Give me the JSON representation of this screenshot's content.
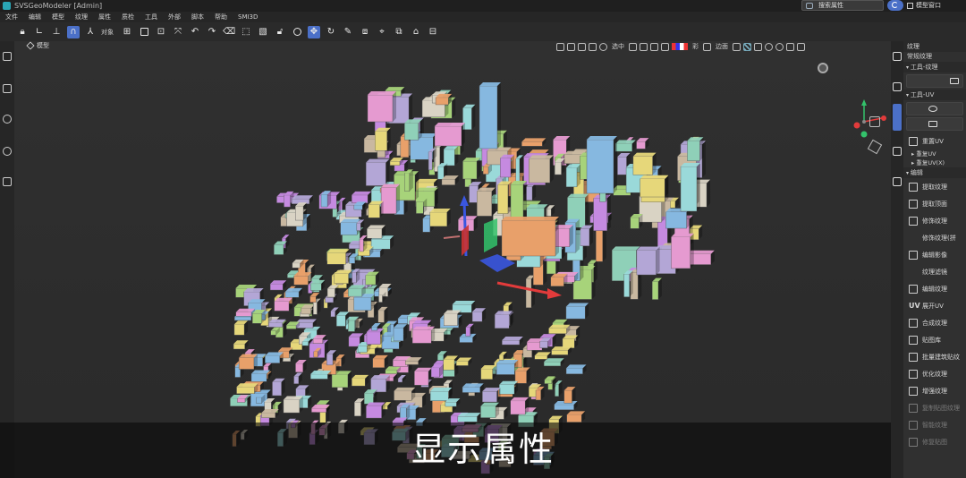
{
  "window": {
    "title": "SVSGeoModeler [Admin]",
    "search_text": "搜索属性",
    "window_menu": "模型窗口"
  },
  "menu": [
    "文件",
    "编辑",
    "模型",
    "纹理",
    "属性",
    "质检",
    "工具",
    "外部",
    "脚本",
    "帮助",
    "SMI3D"
  ],
  "toolbar": {
    "object_label": "对象",
    "active_tool": "move-tool"
  },
  "viewport": {
    "view_mode": "模型",
    "select_label": "选中",
    "color_label": "彩",
    "edge_label": "边面",
    "subtitle": "显示属性"
  },
  "panel": {
    "title": "纹理",
    "subtitle": "常规纹理",
    "sections": {
      "tool_texture": "工具-纹理",
      "tool_uv": "工具-UV",
      "edit": "编辑"
    },
    "uv_items": {
      "reset_uv": "重置UV",
      "tree1": "重复UV",
      "tree2": "重复UV(X)"
    },
    "edit_items": [
      {
        "label": "提取纹理",
        "icon": "upload-icon",
        "dim": false
      },
      {
        "label": "提取顶面",
        "icon": "top-face-icon",
        "dim": false
      },
      {
        "label": "修饰纹理",
        "icon": "doc-image-icon",
        "dim": false
      },
      {
        "label": "修饰纹理(拼",
        "icon": "none",
        "dim": false
      },
      {
        "label": "编辑影像",
        "icon": "doc-icon",
        "dim": false
      },
      {
        "label": "纹理滤镜",
        "icon": "none",
        "dim": false
      },
      {
        "label": "编辑纹理",
        "icon": "checker-icon",
        "dim": false
      },
      {
        "label": "展开UV",
        "icon": "uv-icon",
        "dim": false
      },
      {
        "label": "合成纹理",
        "icon": "layout-icon",
        "dim": false
      },
      {
        "label": "贴图库",
        "icon": "library-icon",
        "dim": false
      },
      {
        "label": "批量建筑贴纹",
        "icon": "building-icon",
        "dim": false
      },
      {
        "label": "优化纹理",
        "icon": "palette-icon",
        "dim": false
      },
      {
        "label": "增强纹理",
        "icon": "image-icon",
        "dim": false
      },
      {
        "label": "复制贴图纹理",
        "icon": "copy-icon",
        "dim": true
      },
      {
        "label": "智能纹理",
        "icon": "smart-icon",
        "dim": true
      },
      {
        "label": "修复贴图",
        "icon": "repair-icon",
        "dim": true
      }
    ]
  },
  "colors": {
    "accent": "#4b70c8",
    "axis_x": "#e23b3b",
    "axis_y": "#33c26b",
    "axis_z": "#3a56e0"
  }
}
